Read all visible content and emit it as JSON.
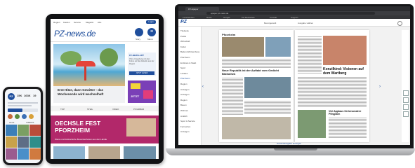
{
  "phone": {
    "logo": "PZ",
    "stats": [
      "15K",
      "163K",
      "19"
    ],
    "bar_labels": [
      "ALLE",
      "VIDEOS"
    ]
  },
  "tablet": {
    "nav": [
      "Region",
      "Kaufen",
      "Service",
      "Magazin",
      "Abo"
    ],
    "login_label": "Login",
    "logo": "PZ-news.de",
    "story_label": "Story",
    "menu_label": "Menü",
    "headline": "Erst Hitze, dann Gewitter - das Wochenende wird wechselhaft",
    "sidebar_title": "PZ-NEWS.APP",
    "sidebar_text": "Ohne Umgebung mit dem Fokus auf das Aktuelle aus der Region",
    "sidebar_link": "JETZT LESEN",
    "ad_text": "JETZT",
    "tabs": [
      "TOP",
      "STEIL",
      "VIDEO",
      "PIXARBAR"
    ],
    "banner_title": "OECHSLE FEST PFORZHEIM",
    "banner_subtitle": "Weine und kulinarische Besonderheiten aus den Ländle"
  },
  "laptop": {
    "browser_tab": "PZ-Epaper",
    "url": "epaper.pz-news.de",
    "bookmarks": [
      "Lesezeichen",
      "News",
      "Google",
      "PZ-Mediathek",
      "Kontakt",
      "Support"
    ],
    "toolbar_left": "Bereitgestellt",
    "toolbar_right": "Ausgabe wählen",
    "logo": "PZ",
    "sidebar_items": [
      "Titelseite",
      "Politik",
      "Wirtschaft",
      "Kultur",
      "Baden-Württemberg",
      "Pforzheim",
      "Enzkreis & Stadt",
      "Sport",
      "Lokales",
      "Pforzheim",
      "Region",
      "Anzeigen",
      "Anzeigen",
      "Region",
      "Bauen",
      "Wohnen",
      "Amtlich",
      "Sport & Service",
      "Fernsehen",
      "Anzeigen"
    ],
    "page_header": "Pforzheim",
    "headline_1": "Neue Republik ist der Auftakt vom Gedicht Bibliothek",
    "headline_2": "Konzilkind: Visionen auf dem Wartberg",
    "headline_3": "Viel Applaus für besondere Pfingsten",
    "footer_link": "Gesamtausgabe anzeigen"
  }
}
